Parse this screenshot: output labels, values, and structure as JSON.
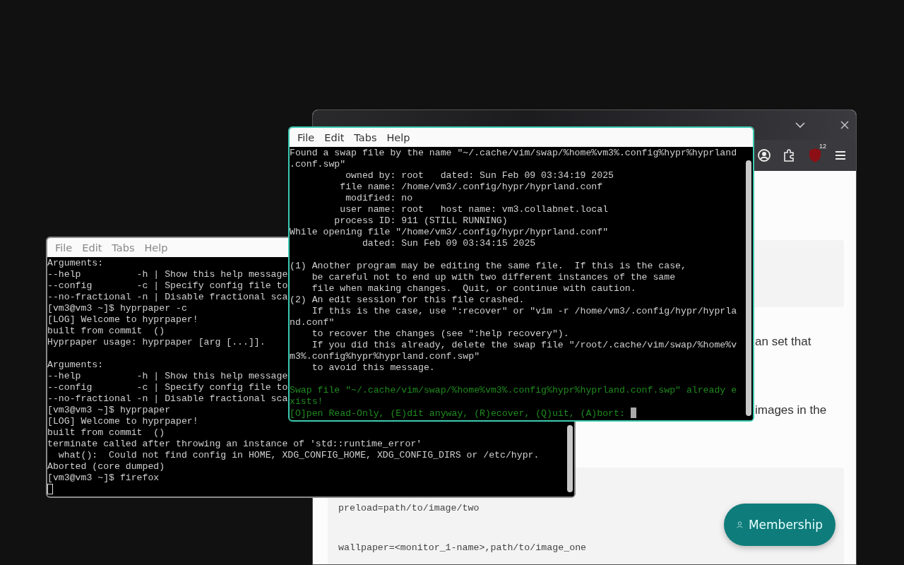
{
  "browser": {
    "toolbar": {
      "extensions_badge": "12"
    },
    "content": {
      "paragraphs": [
        "an set that",
        "images in the"
      ],
      "code_lines": [
        "preload=path/to/image/two",
        "wallpaper=<monitor_1-name>,path/to/image_one"
      ],
      "membership_button": "Membership"
    }
  },
  "terminals": [
    {
      "focused": false,
      "menu": [
        "File",
        "Edit",
        "Tabs",
        "Help"
      ],
      "blocks": [
        {
          "kind": "output",
          "lines": [
            "Arguments:",
            "--help          -h | Show this help message",
            "--config        -c | Specify config file to",
            "--no-fractional -n | Disable fractional sca",
            "[vm3@vm3 ~]$ hyprpaper -c",
            "[LOG] Welcome to hyprpaper!",
            "built from commit  ()",
            "Hyprpaper usage: hyprpaper [arg [...]]."
          ]
        },
        {
          "kind": "output",
          "lines": [
            "Arguments:",
            "--help          -h | Show this help message",
            "--config        -c | Specify config file to",
            "--no-fractional -n | Disable fractional sca",
            "[vm3@vm3 ~]$ hyprpaper",
            "[LOG] Welcome to hyprpaper!",
            "built from commit  ()",
            "terminate called after throwing an instance of 'std::runtime_error'",
            "  what():  Could not find config in HOME, XDG_CONFIG_HOME, XDG_CONFIG_DIRS or /etc/hypr.",
            "Aborted (core dumped)",
            "[vm3@vm3 ~]$ firefox"
          ]
        }
      ]
    },
    {
      "focused": true,
      "menu": [
        "File",
        "Edit",
        "Tabs",
        "Help"
      ],
      "blocks": [
        {
          "kind": "output",
          "lines": [
            "Found a swap file by the name \"~/.cache/vim/swap/%home%vm3%.config%hypr%hyprland",
            ".conf.swp\"",
            "          owned by: root   dated: Sun Feb 09 03:34:19 2025",
            "         file name: /home/vm3/.config/hypr/hyprland.conf",
            "          modified: no",
            "         user name: root   host name: vm3.collabnet.local",
            "        process ID: 911 (STILL RUNNING)",
            "While opening file \"/home/vm3/.config/hypr/hyprland.conf\"",
            "             dated: Sun Feb 09 03:34:15 2025"
          ]
        },
        {
          "kind": "output",
          "lines": [
            "(1) Another program may be editing the same file.  If this is the case,",
            "    be careful not to end up with two different instances of the same",
            "    file when making changes.  Quit, or continue with caution.",
            "(2) An edit session for this file crashed.",
            "    If this is the case, use \":recover\" or \"vim -r /home/vm3/.config/hypr/hyprla",
            "nd.conf\"",
            "    to recover the changes (see \":help recovery\").",
            "    If you did this already, delete the swap file \"/root/.cache/vim/swap/%home%v",
            "m3%.config%hypr%hyprland.conf.swp\"",
            "    to avoid this message."
          ]
        },
        {
          "kind": "prompt",
          "lines": [
            "Swap file \"~/.cache/vim/swap/%home%vm3%.config%hypr%hyprland.conf.swp\" already e",
            "xists!",
            "[O]pen Read-Only, (E)dit anyway, (R)ecover, (Q)uit, (A)bort: "
          ]
        }
      ]
    }
  ]
}
